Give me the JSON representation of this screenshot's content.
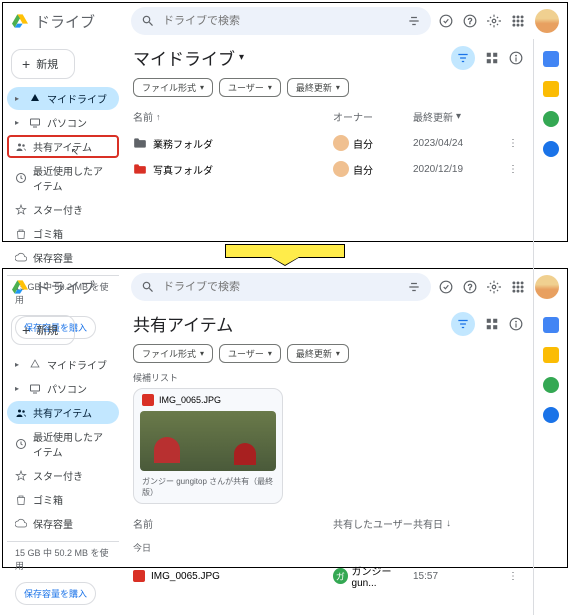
{
  "app_title": "ドライブ",
  "search_placeholder": "ドライブで検索",
  "new_button": "新規",
  "sidebar": {
    "mydrive": "マイドライブ",
    "computers": "パソコン",
    "shared": "共有アイテム",
    "recent": "最近使用したアイテム",
    "starred": "スター付き",
    "trash": "ゴミ箱",
    "storage": "保存容量"
  },
  "storage_text": "15 GB 中 50.2 MB を使用",
  "buy_storage": "保存容量を購入",
  "panel_a": {
    "title": "マイドライブ",
    "chips": [
      "ファイル形式",
      "ユーザー",
      "最終更新"
    ],
    "cols": {
      "name": "名前",
      "owner": "オーナー",
      "updated": "最終更新"
    },
    "rows": [
      {
        "name": "業務フォルダ",
        "owner": "自分",
        "date": "2023/04/24",
        "color": "#5f6368"
      },
      {
        "name": "写真フォルダ",
        "owner": "自分",
        "date": "2020/12/19",
        "color": "#d93025"
      }
    ]
  },
  "panel_b": {
    "title": "共有アイテム",
    "chips": [
      "ファイル形式",
      "ユーザー",
      "最終更新"
    ],
    "section": "候補リスト",
    "card": {
      "name": "IMG_0065.JPG",
      "foot": "ガンジー gungitop さんが共有（最終版）"
    },
    "cols": {
      "name": "名前",
      "shared_by": "共有したユーザー",
      "shared_date": "共有日"
    },
    "group": "今日",
    "rows": [
      {
        "name": "IMG_0065.JPG",
        "owner_initial": "ガ",
        "owner": "ガンジー gun...",
        "date": "15:57"
      }
    ]
  }
}
